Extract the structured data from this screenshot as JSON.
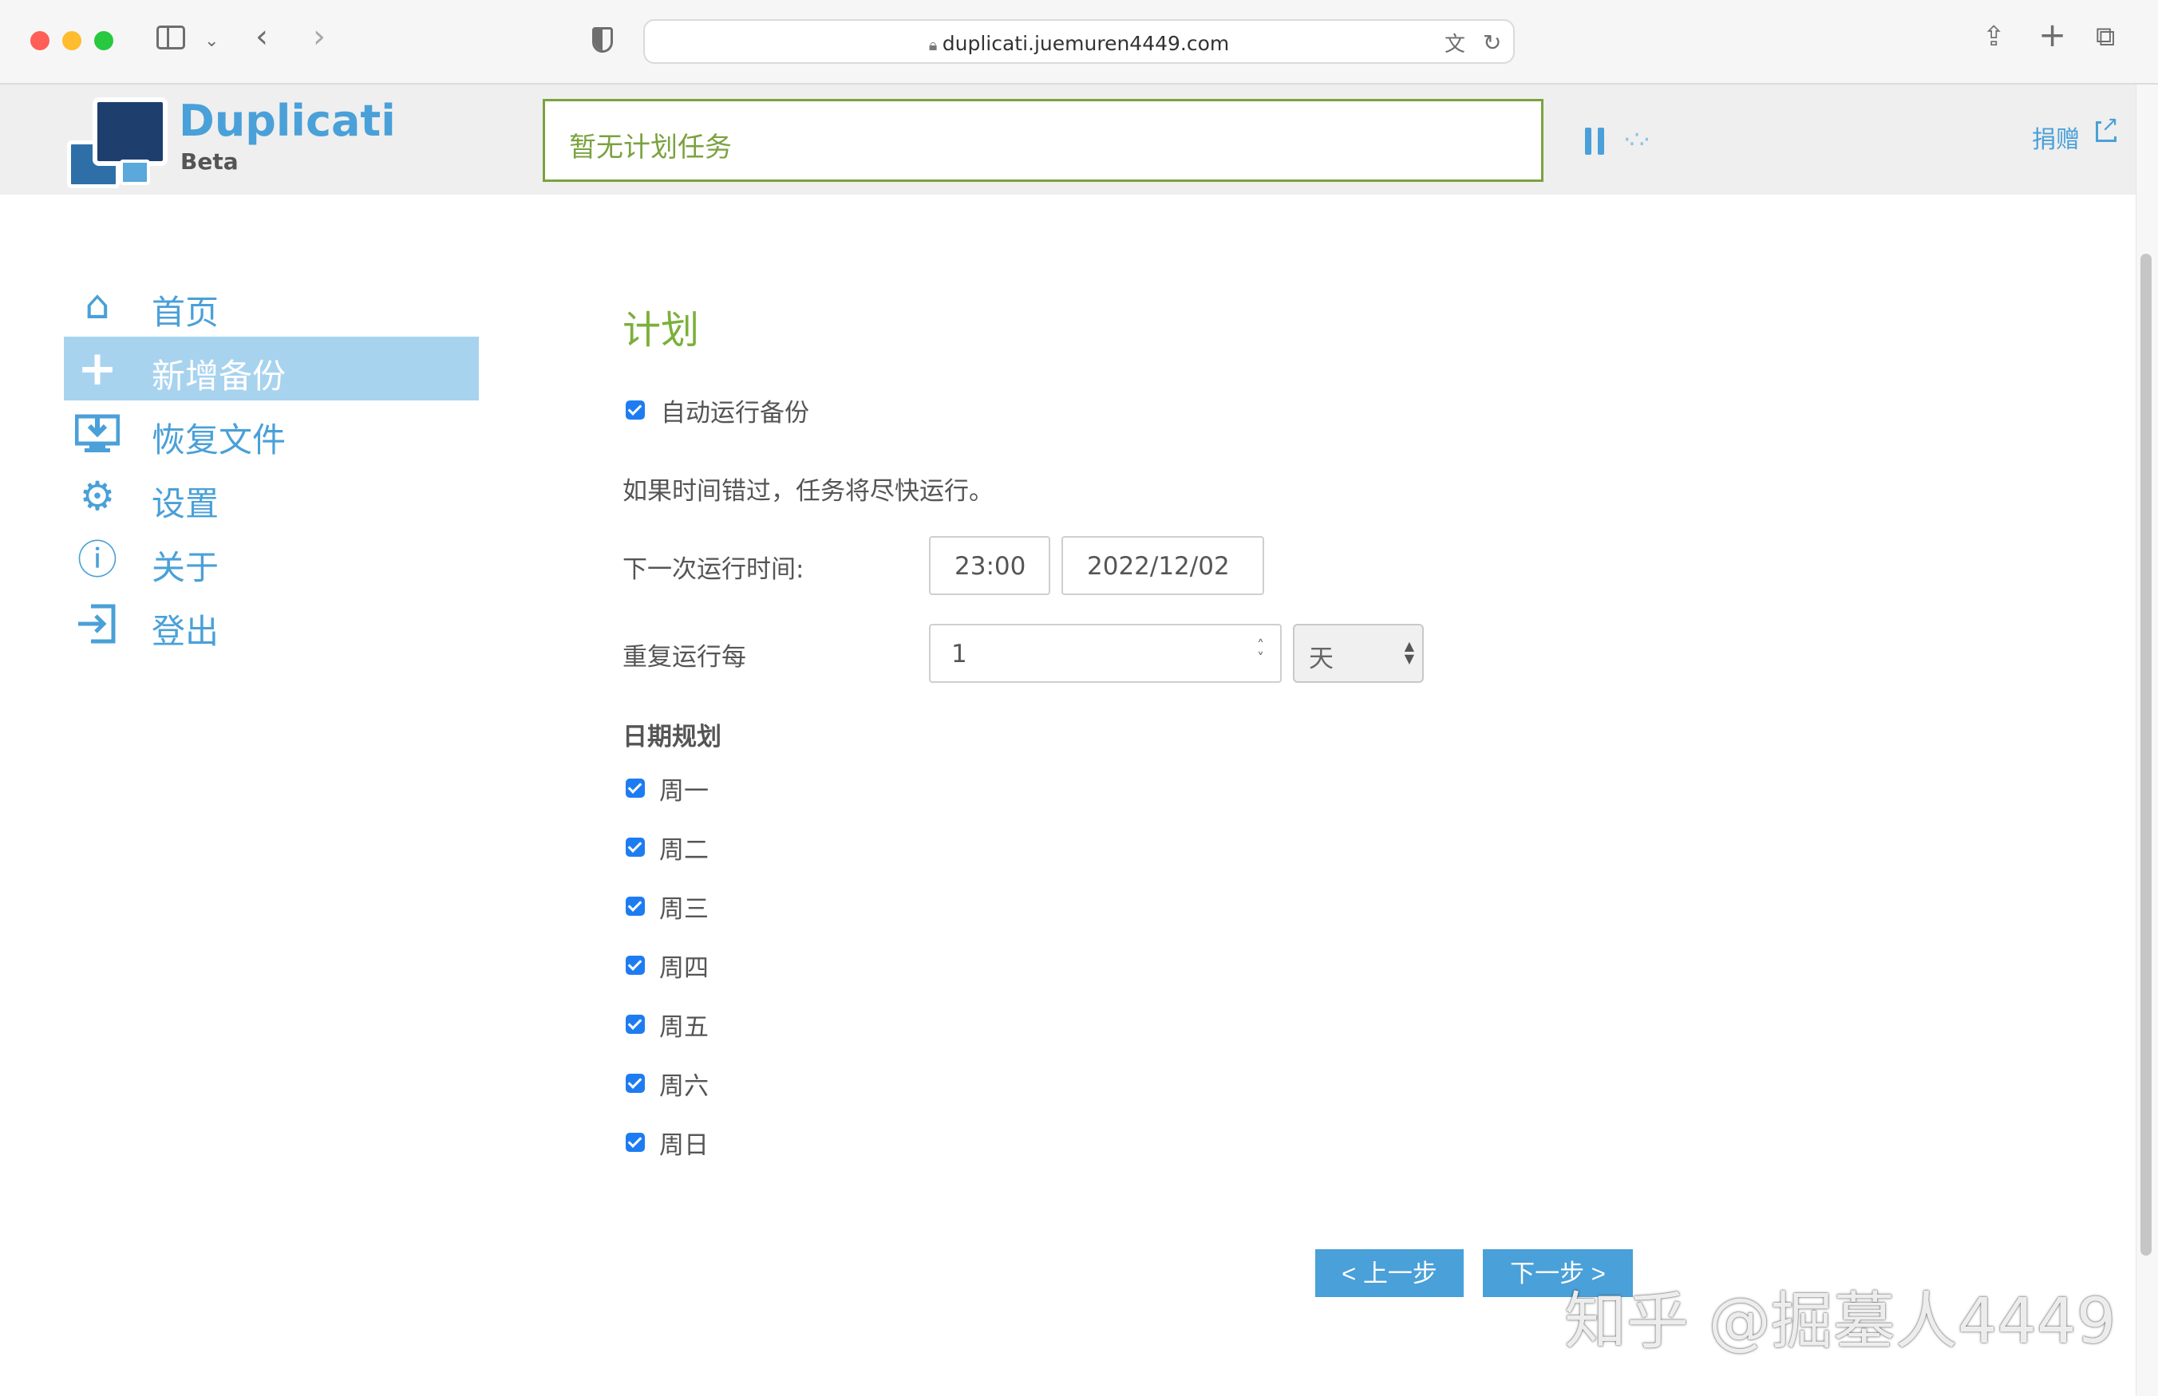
{
  "browser": {
    "url": "duplicati.juemuren4449.com"
  },
  "header": {
    "brand": "Duplicati",
    "brand_sub": "Beta",
    "status": "暂无计划任务",
    "donate": "捐赠"
  },
  "sidebar": {
    "items": [
      {
        "label": "首页",
        "icon": "home-icon",
        "active": false
      },
      {
        "label": "新增备份",
        "icon": "plus-icon",
        "active": true
      },
      {
        "label": "恢复文件",
        "icon": "restore-icon",
        "active": false
      },
      {
        "label": "设置",
        "icon": "gear-icon",
        "active": false
      },
      {
        "label": "关于",
        "icon": "info-icon",
        "active": false
      },
      {
        "label": "登出",
        "icon": "logout-icon",
        "active": false
      }
    ]
  },
  "schedule": {
    "title": "计划",
    "auto_run_label": "自动运行备份",
    "auto_run_checked": true,
    "note": "如果时间错过，任务将尽快运行。",
    "next_run_label": "下一次运行时间:",
    "next_run_time": "23:00",
    "next_run_date": "2022/12/02",
    "repeat_label": "重复运行每",
    "repeat_value": "1",
    "repeat_unit": "天",
    "days_heading": "日期规划",
    "days": [
      {
        "label": "周一",
        "checked": true
      },
      {
        "label": "周二",
        "checked": true
      },
      {
        "label": "周三",
        "checked": true
      },
      {
        "label": "周四",
        "checked": true
      },
      {
        "label": "周五",
        "checked": true
      },
      {
        "label": "周六",
        "checked": true
      },
      {
        "label": "周日",
        "checked": true
      }
    ]
  },
  "buttons": {
    "prev": "< 上一步",
    "next": "下一步 >"
  },
  "watermark": "知乎 @掘墓人4449",
  "colors": {
    "accent": "#4aa0d8",
    "active_nav": "#a8d3ef",
    "title_green": "#7bb03a",
    "status_border": "#7ba23f",
    "checkbox": "#1e7cf2"
  }
}
